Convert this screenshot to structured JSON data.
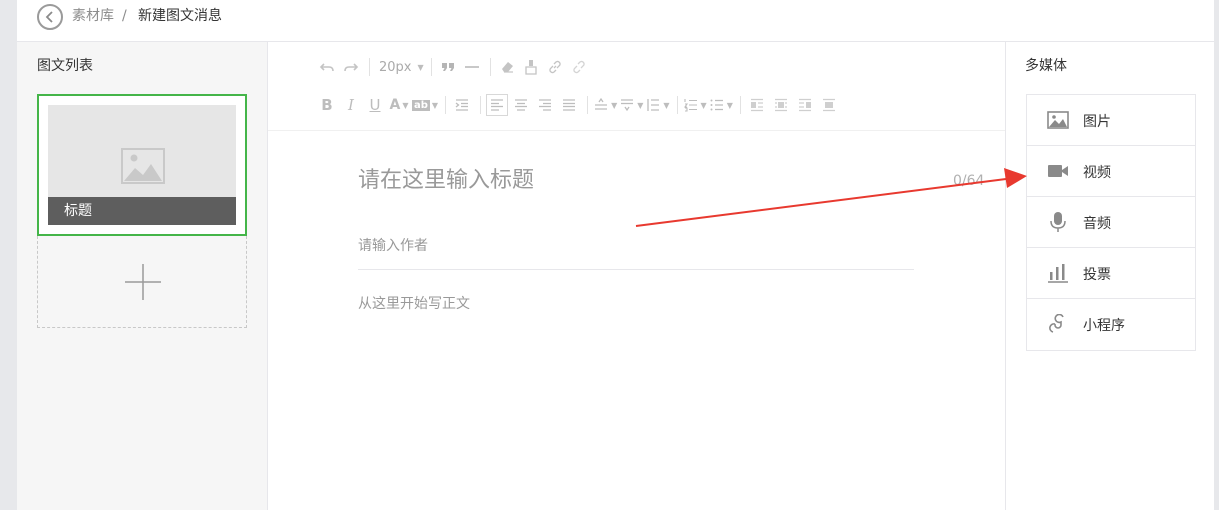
{
  "breadcrumb": {
    "parent": "素材库",
    "separator": "/",
    "current": "新建图文消息"
  },
  "left_panel": {
    "title": "图文列表",
    "article": {
      "title": "标题"
    }
  },
  "toolbar": {
    "font_size": "20px"
  },
  "editor": {
    "title_placeholder": "请在这里输入标题",
    "title_count": "0/64",
    "author_placeholder": "请输入作者",
    "body_placeholder": "从这里开始写正文"
  },
  "right_panel": {
    "title": "多媒体",
    "items": [
      {
        "label": "图片",
        "icon": "image-icon"
      },
      {
        "label": "视频",
        "icon": "video-icon"
      },
      {
        "label": "音频",
        "icon": "microphone-icon"
      },
      {
        "label": "投票",
        "icon": "vote-icon"
      },
      {
        "label": "小程序",
        "icon": "mini-program-icon"
      }
    ]
  },
  "colors": {
    "accent_green": "#44b549",
    "annotation_red": "#e8392f",
    "sidebar_bg": "#f6f6f6",
    "cover_label_bg": "#5e5e5e"
  }
}
